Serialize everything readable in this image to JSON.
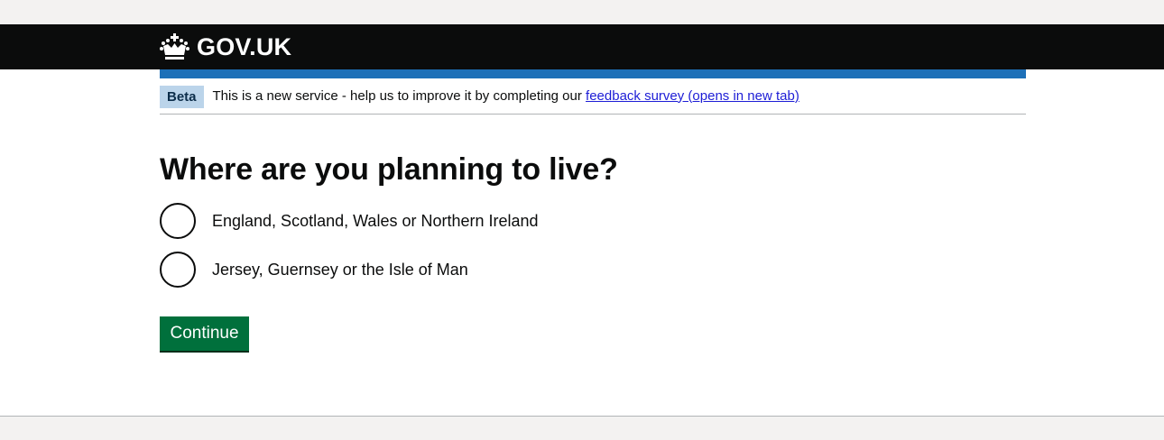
{
  "header": {
    "logo_text": "GOV.UK",
    "logo_icon": "crown-icon"
  },
  "phase_banner": {
    "tag": "Beta",
    "text": "This is a new service - help us to improve it by completing our ",
    "link_text": "feedback survey (opens in new tab)"
  },
  "question": {
    "heading": "Where are you planning to live?",
    "options": [
      {
        "label": "England, Scotland, Wales or Northern Ireland",
        "selected": false
      },
      {
        "label": "Jersey, Guernsey or the Isle of Man",
        "selected": false
      }
    ]
  },
  "actions": {
    "continue_label": "Continue"
  },
  "colors": {
    "header_bg": "#0b0c0c",
    "accent_blue": "#1d70b8",
    "button_green": "#00703c",
    "tag_bg": "#bbd4ea",
    "link": "#1d1dd6"
  }
}
